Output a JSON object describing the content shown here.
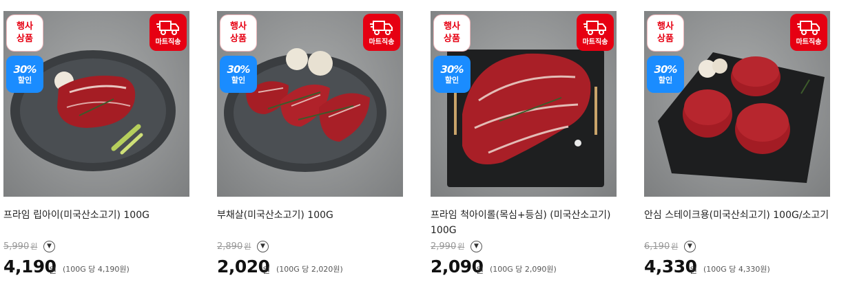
{
  "colors": {
    "event_red": "#e60012",
    "discount_blue": "#1a8cff",
    "strike_gray": "#999999"
  },
  "badges": {
    "event_line1": "행사",
    "event_line2": "상품",
    "discount_pct": "30%",
    "discount_label": "할인",
    "delivery_label": "마트직송",
    "delivery_icon": "delivery-truck-icon"
  },
  "products": [
    {
      "name": "프라임 립아이(미국산소고기) 100G",
      "original_price": "5,990",
      "original_unit": "원",
      "price": "4,190",
      "price_unit": "원",
      "unit_price": "(100G 당 4,190원)"
    },
    {
      "name": "부채살(미국산소고기) 100G",
      "original_price": "2,890",
      "original_unit": "원",
      "price": "2,020",
      "price_unit": "원",
      "unit_price": "(100G 당 2,020원)"
    },
    {
      "name": "프라임 척아이롤(목심+등심) (미국산소고기) 100G",
      "original_price": "2,990",
      "original_unit": "원",
      "price": "2,090",
      "price_unit": "원",
      "unit_price": "(100G 당 2,090원)"
    },
    {
      "name": "안심 스테이크용(미국산쇠고기) 100G/소고기",
      "original_price": "6,190",
      "original_unit": "원",
      "price": "4,330",
      "price_unit": "원",
      "unit_price": "(100G 당 4,330원)"
    }
  ]
}
